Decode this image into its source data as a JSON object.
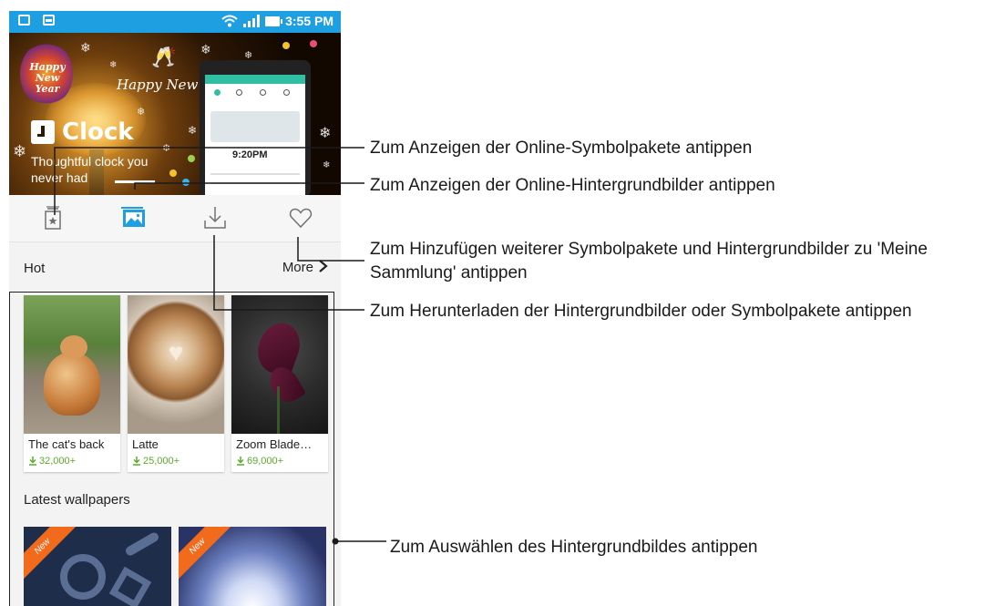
{
  "status_bar": {
    "time": "3:55 PM"
  },
  "banner": {
    "greeting_logo": "Happy New Year",
    "greeting_script": "Happy New Year",
    "app_title": "Clock",
    "app_subtitle": "Thoughtful clock you never had",
    "mockup_time": "9:20PM"
  },
  "tabs": [
    {
      "icon": "icon-pack-icon",
      "active": false
    },
    {
      "icon": "wallpaper-icon",
      "active": true
    },
    {
      "icon": "download-icon",
      "active": false
    },
    {
      "icon": "heart-icon",
      "active": false
    }
  ],
  "hot_section": {
    "label": "Hot",
    "more_label": "More"
  },
  "hot_items": [
    {
      "title": "The cat's back",
      "downloads": "32,000+"
    },
    {
      "title": "Latte",
      "downloads": "25,000+"
    },
    {
      "title": "Zoom Blade…",
      "downloads": "69,000+"
    }
  ],
  "latest_section": {
    "label": "Latest wallpapers"
  },
  "latest_items": [
    {
      "badge": "New"
    },
    {
      "badge": "New"
    }
  ],
  "callouts": {
    "icon_packs": "Zum Anzeigen der Online-Symbolpakete antippen",
    "wallpapers": "Zum Anzeigen der Online-Hintergrundbilder antippen",
    "collection": "Zum Hinzufügen weiterer Symbolpakete und Hintergrundbilder zu 'Meine Sammlung' antippen",
    "download": "Zum Herunterladen der Hintergrundbilder oder Symbolpakete antippen",
    "select": "Zum Auswählen des Hintergrundbildes antippen"
  },
  "colors": {
    "status_bar": "#1e9fe2",
    "active_tab": "#1e9fe2",
    "download_count": "#5aab2b",
    "new_ribbon": "#f26a1b"
  }
}
